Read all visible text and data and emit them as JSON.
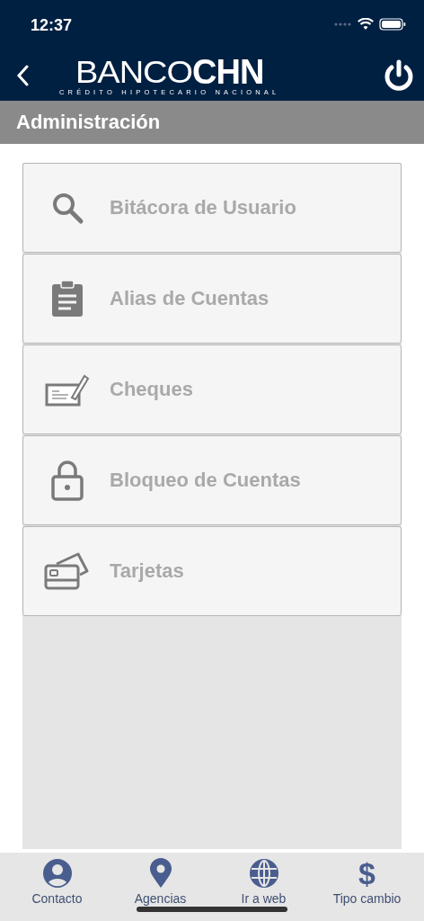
{
  "status_bar": {
    "time": "12:37"
  },
  "header": {
    "logo": {
      "word_1": "BANCO",
      "word_2": "CHN",
      "tagline": "CRÉDITO HIPOTECARIO NACIONAL"
    }
  },
  "section": {
    "title": "Administración"
  },
  "menu": [
    {
      "label": "Bitácora de Usuario",
      "kind": "search"
    },
    {
      "label": "Alias de Cuentas",
      "kind": "clipboard"
    },
    {
      "label": "Cheques",
      "kind": "cheque"
    },
    {
      "label": "Bloqueo de Cuentas",
      "kind": "lock"
    },
    {
      "label": "Tarjetas",
      "kind": "cards"
    }
  ],
  "tab_bar": [
    {
      "label": "Contacto",
      "kind": "person"
    },
    {
      "label": "Agencias",
      "kind": "pin"
    },
    {
      "label": "Ir a web",
      "kind": "globe"
    },
    {
      "label": "Tipo cambio",
      "kind": "glyph",
      "glyph": "$"
    }
  ]
}
